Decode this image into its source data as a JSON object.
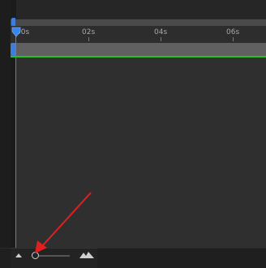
{
  "ruler": {
    "ticks": [
      "00s",
      "02s",
      "04s",
      "06s"
    ]
  },
  "playhead": {
    "time": "00s"
  },
  "zoom": {
    "level": 0.0
  },
  "colors": {
    "accent": "#3b86e8",
    "work_area_end": "#24c420",
    "annotation_arrow": "#e02020"
  },
  "icons": {
    "zoom_out": "zoom-out-mountain-icon",
    "zoom_in": "zoom-in-mountain-icon",
    "annotation": "red-arrow-icon"
  }
}
